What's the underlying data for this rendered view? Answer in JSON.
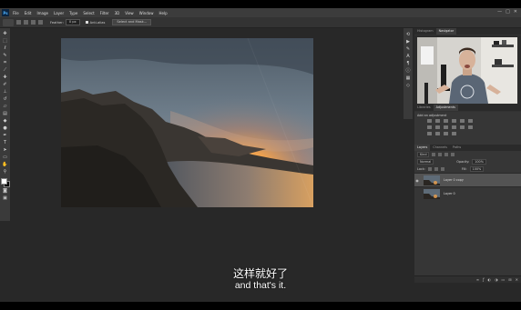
{
  "app": {
    "logo": "Ps"
  },
  "menubar": {
    "items": [
      "File",
      "Edit",
      "Image",
      "Layer",
      "Type",
      "Select",
      "Filter",
      "3D",
      "View",
      "Window",
      "Help"
    ]
  },
  "window_controls": [
    "—",
    "□",
    "✕"
  ],
  "options_bar": {
    "style_label": "Feather:",
    "style_value": "0 px",
    "anti_alias_label": "Anti-alias",
    "select_mask_button": "Select and Mask..."
  },
  "tools": [
    "move-icon",
    "marquee-icon",
    "lasso-icon",
    "quick-select-icon",
    "crop-icon",
    "eyedropper-icon",
    "healing-icon",
    "brush-icon",
    "stamp-icon",
    "history-brush-icon",
    "eraser-icon",
    "gradient-icon",
    "blur-icon",
    "dodge-icon",
    "pen-icon",
    "type-icon",
    "path-select-icon",
    "shape-icon",
    "hand-icon",
    "zoom-icon"
  ],
  "panel_tabs": {
    "histogram": "Histogram",
    "navigator": "Navigator"
  },
  "adjust_tabs": {
    "libraries": "Libraries",
    "adjustments": "Adjustments"
  },
  "adjust_title": "Add an adjustment",
  "layers_tabs": {
    "layers": "Layers",
    "channels": "Channels",
    "paths": "Paths"
  },
  "layers_panel": {
    "kind": "Kind",
    "blend_mode": "Normal",
    "opacity_label": "Opacity:",
    "opacity_value": "100%",
    "lock_label": "Lock:",
    "fill_label": "Fill:",
    "fill_value": "100%",
    "layers": [
      {
        "name": "Layer 0 copy",
        "selected": true
      },
      {
        "name": "Layer 0",
        "selected": false
      }
    ]
  },
  "subtitles": {
    "zh": "这样就好了",
    "en": "and that's it."
  },
  "colors": {
    "accent": "#31a8ff",
    "background": "#282828",
    "panel": "#323232"
  }
}
